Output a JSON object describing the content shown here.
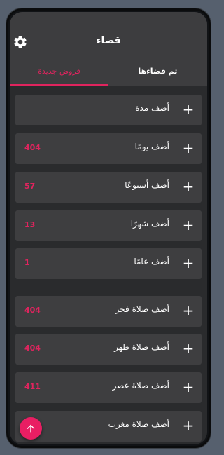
{
  "header": {
    "title": "قضاء",
    "settings_icon": "gear-icon"
  },
  "tabs": [
    {
      "label": "تم قضاءها",
      "active": false
    },
    {
      "label": "فروض جديدة",
      "active": true
    }
  ],
  "rows": [
    {
      "label": "أضف مدة",
      "count": ""
    },
    {
      "label": "أضف يومًا",
      "count": "404"
    },
    {
      "label": "أضف أسبوعًا",
      "count": "57"
    },
    {
      "label": "أضف شهرًا",
      "count": "13"
    },
    {
      "label": "أضف عامًا",
      "count": "1"
    },
    {
      "label": "أضف صلاة فجر",
      "count": "404"
    },
    {
      "label": "أضف صلاة ظهر",
      "count": "404"
    },
    {
      "label": "أضف صلاة عصر",
      "count": "411"
    },
    {
      "label": "أضف صلاة مغرب",
      "count": ""
    }
  ],
  "plus_glyph": "+",
  "fab_icon": "arrow-up-icon",
  "colors": {
    "accent": "#e0245e",
    "appbar": "#3d3d3f",
    "background": "#2a2b2d",
    "row": "#3e3e40"
  }
}
